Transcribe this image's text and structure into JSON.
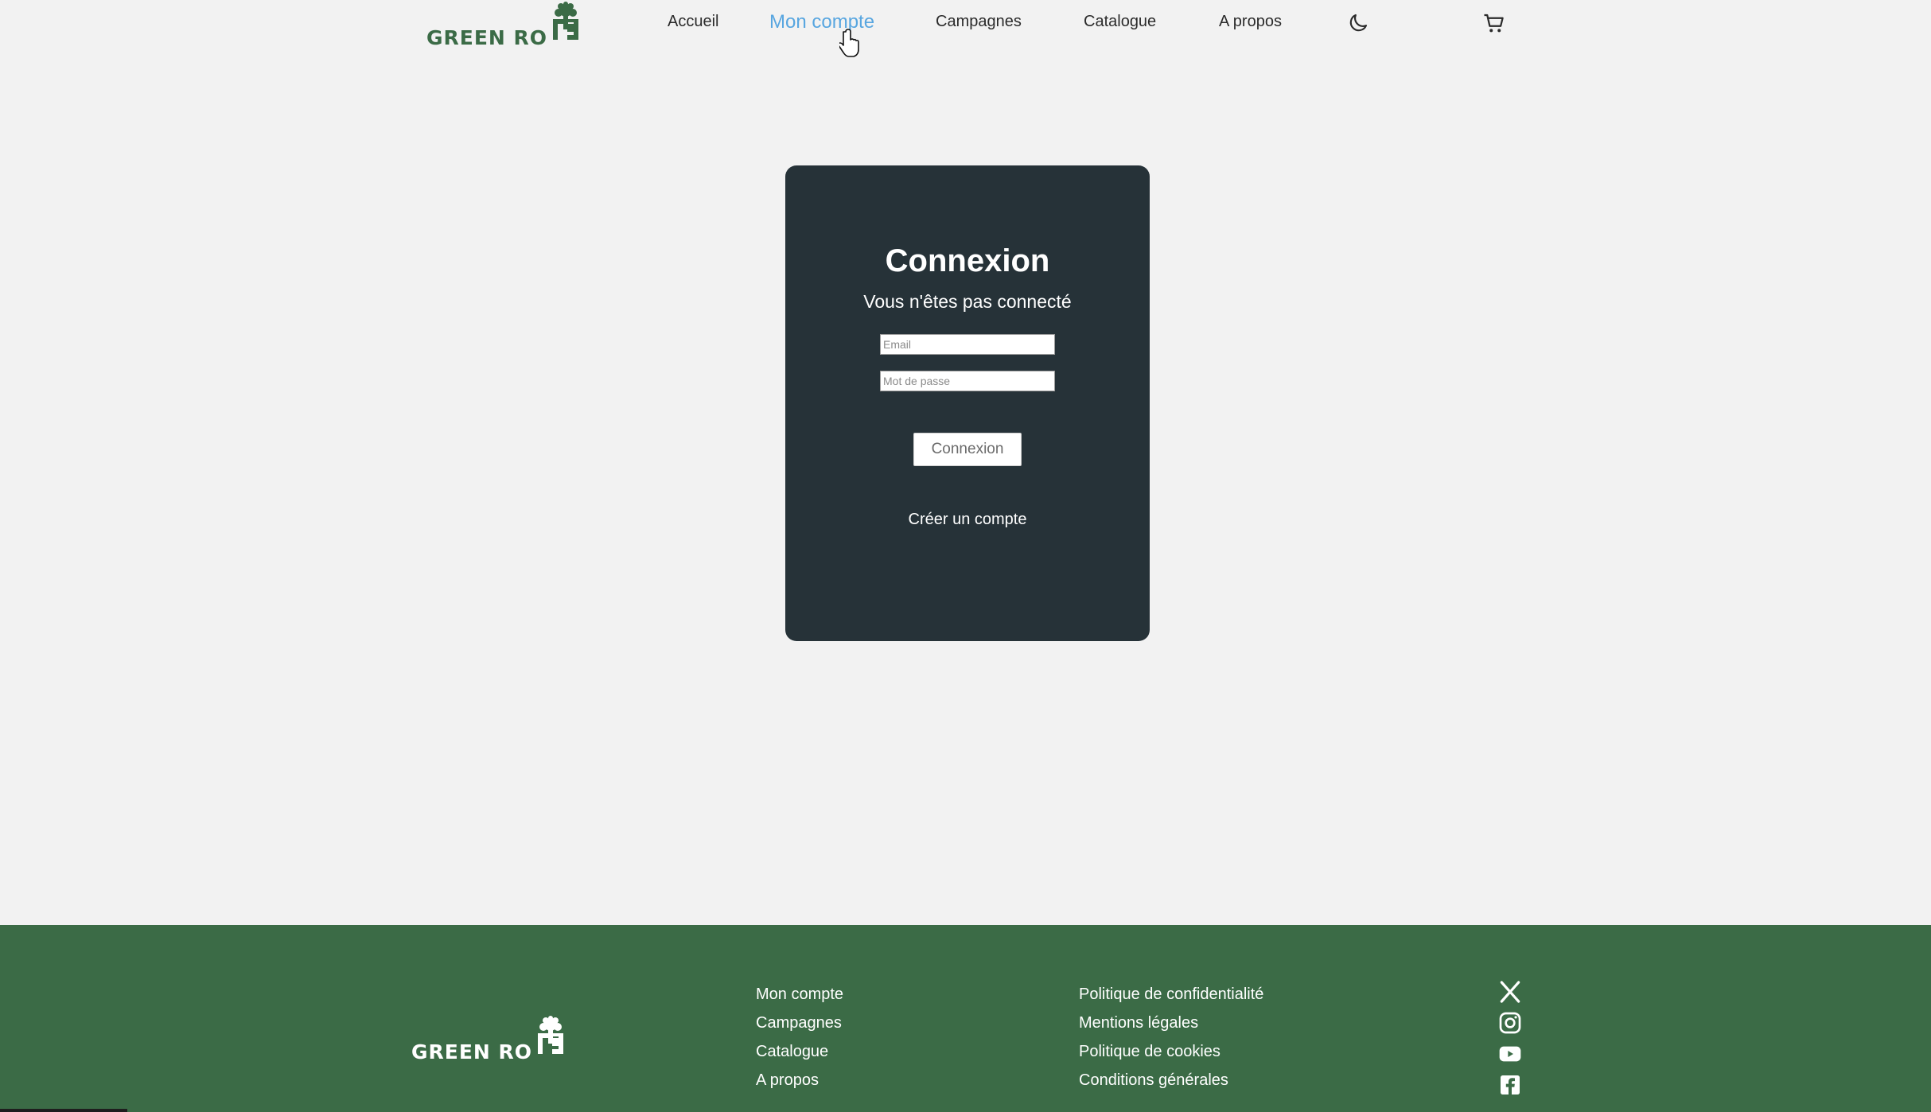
{
  "brand": {
    "logo_text_left": "GREEN RO",
    "logo_text_right": "S"
  },
  "nav": {
    "items": [
      "Accueil",
      "Mon compte",
      "Campagnes",
      "Catalogue",
      "A propos"
    ],
    "active": "Mon compte",
    "theme_icon": "moon-icon",
    "cart_icon": "cart-icon"
  },
  "login": {
    "title": "Connexion",
    "subtitle": "Vous n'êtes pas connecté",
    "email_placeholder": "Email",
    "password_placeholder": "Mot de passe",
    "submit_label": "Connexion",
    "create_account": "Créer un compte"
  },
  "footer": {
    "links_col1": [
      "Mon compte",
      "Campagnes",
      "Catalogue",
      "A propos"
    ],
    "links_col2": [
      "Politique de confidentialité",
      "Mentions légales",
      "Politique de cookies",
      "Conditions générales"
    ],
    "social_icons": [
      "x-icon",
      "instagram-icon",
      "youtube-icon",
      "facebook-icon"
    ]
  },
  "colors": {
    "page_bg": "#f2f2f2",
    "card_bg": "#263238",
    "footer_bg": "#3b6b46",
    "nav_active": "#58a6e0",
    "brand_green": "#3b6b46"
  }
}
